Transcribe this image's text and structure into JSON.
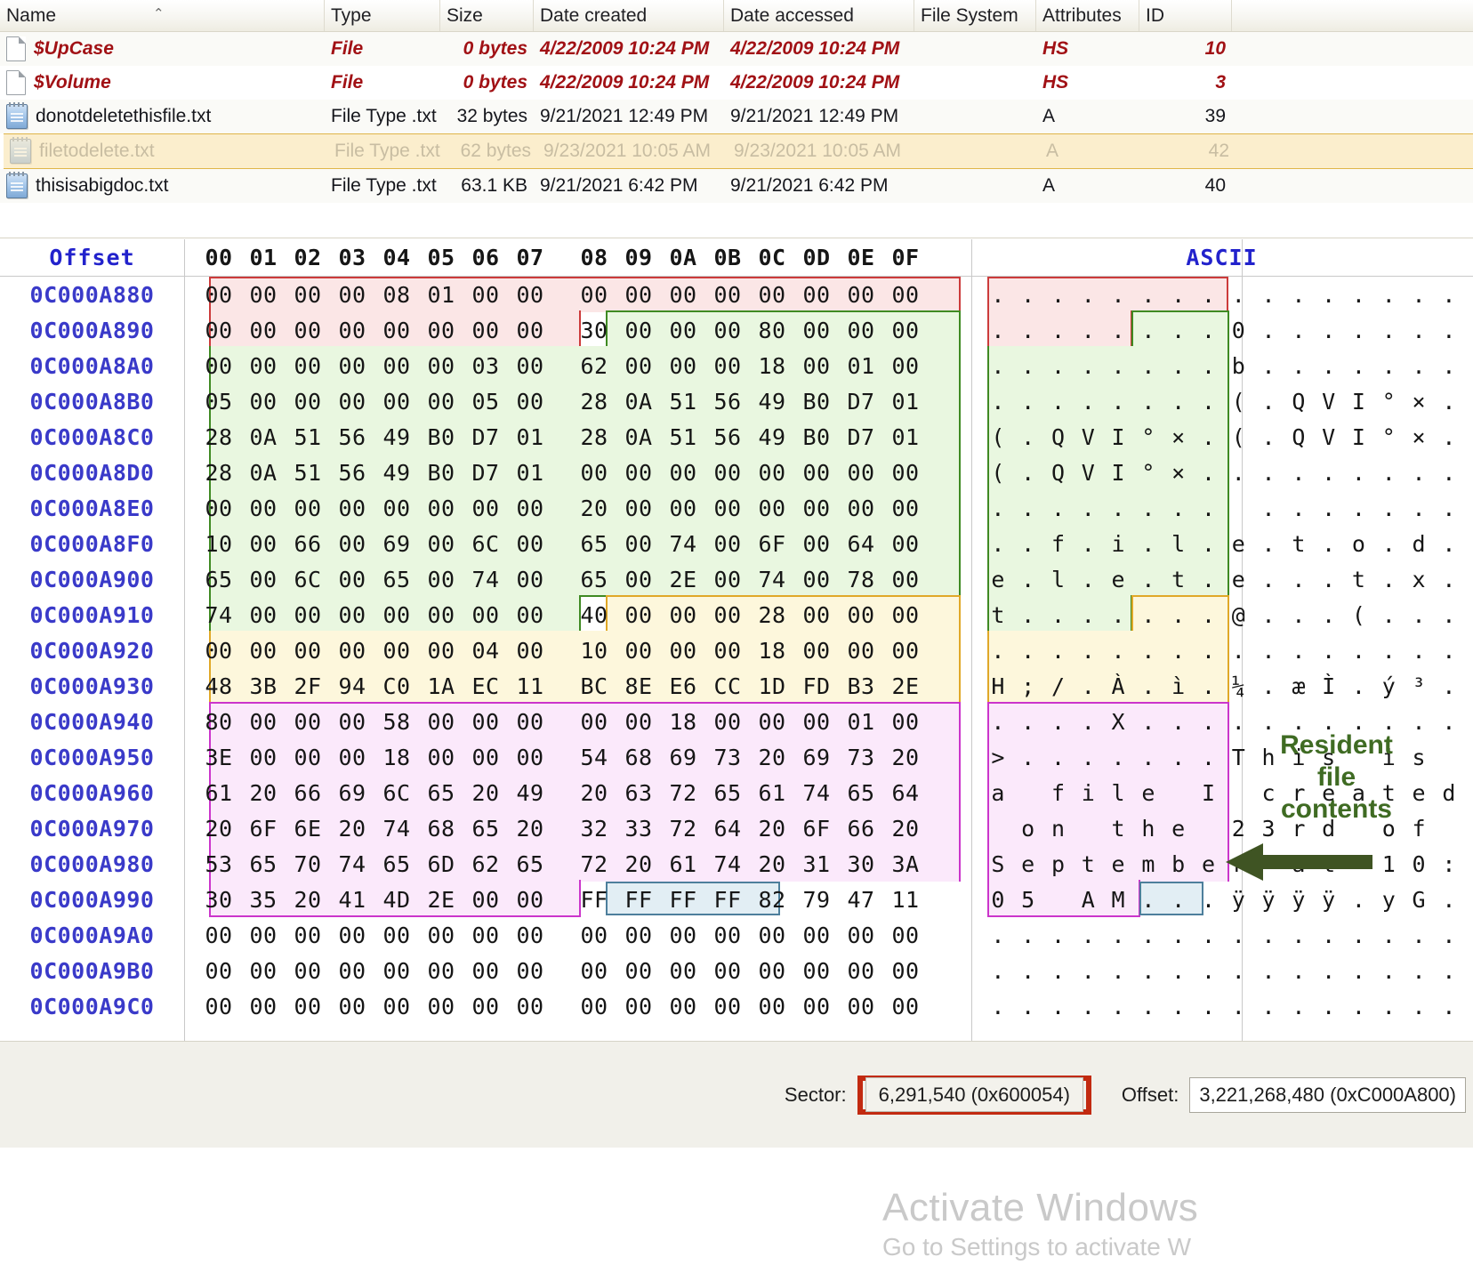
{
  "filelist": {
    "columns": [
      "Name",
      "Type",
      "Size",
      "Date created",
      "Date accessed",
      "File System",
      "Attributes",
      "ID"
    ],
    "sort_indicator": "⌃",
    "rows": [
      {
        "icon": "document-icon",
        "name": "$UpCase",
        "type": "File",
        "size": "0 bytes",
        "created": "4/22/2009 10:24 PM",
        "accessed": "4/22/2009 10:24 PM",
        "fs": "",
        "attr": "HS",
        "id": "10",
        "style": "system"
      },
      {
        "icon": "document-icon",
        "name": "$Volume",
        "type": "File",
        "size": "0 bytes",
        "created": "4/22/2009 10:24 PM",
        "accessed": "4/22/2009 10:24 PM",
        "fs": "",
        "attr": "HS",
        "id": "3",
        "style": "system"
      },
      {
        "icon": "notepad-icon",
        "name": "donotdeletethisfile.txt",
        "type": "File Type .txt",
        "size": "32 bytes",
        "created": "9/21/2021 12:49 PM",
        "accessed": "9/21/2021 12:49 PM",
        "fs": "",
        "attr": "A",
        "id": "39",
        "style": "normal"
      },
      {
        "icon": "notepad-icon",
        "name": "filetodelete.txt",
        "type": "File Type .txt",
        "size": "62 bytes",
        "created": "9/23/2021 10:05 AM",
        "accessed": "9/23/2021 10:05 AM",
        "fs": "",
        "attr": "A",
        "id": "42",
        "style": "deleted-selected"
      },
      {
        "icon": "notepad-icon",
        "name": "thisisabigdoc.txt",
        "type": "File Type .txt",
        "size": "63.1 KB",
        "created": "9/21/2021 6:42 PM",
        "accessed": "9/21/2021 6:42 PM",
        "fs": "",
        "attr": "A",
        "id": "40",
        "style": "normal"
      }
    ]
  },
  "hexview": {
    "header": {
      "offset_label": "Offset",
      "byte_columns": [
        "00",
        "01",
        "02",
        "03",
        "04",
        "05",
        "06",
        "07",
        "08",
        "09",
        "0A",
        "0B",
        "0C",
        "0D",
        "0E",
        "0F"
      ],
      "ascii_label": "ASCII"
    },
    "rows": [
      {
        "offset": "0C000A880",
        "bytes": [
          "00",
          "00",
          "00",
          "00",
          "08",
          "01",
          "00",
          "00",
          "00",
          "00",
          "00",
          "00",
          "00",
          "00",
          "00",
          "00"
        ],
        "ascii": "................"
      },
      {
        "offset": "0C000A890",
        "bytes": [
          "00",
          "00",
          "00",
          "00",
          "00",
          "00",
          "00",
          "00",
          "30",
          "00",
          "00",
          "00",
          "80",
          "00",
          "00",
          "00"
        ],
        "ascii": "........0......."
      },
      {
        "offset": "0C000A8A0",
        "bytes": [
          "00",
          "00",
          "00",
          "00",
          "00",
          "00",
          "03",
          "00",
          "62",
          "00",
          "00",
          "00",
          "18",
          "00",
          "01",
          "00"
        ],
        "ascii": "........b......."
      },
      {
        "offset": "0C000A8B0",
        "bytes": [
          "05",
          "00",
          "00",
          "00",
          "00",
          "00",
          "05",
          "00",
          "28",
          "0A",
          "51",
          "56",
          "49",
          "B0",
          "D7",
          "01"
        ],
        "ascii": "........(.QVI°×."
      },
      {
        "offset": "0C000A8C0",
        "bytes": [
          "28",
          "0A",
          "51",
          "56",
          "49",
          "B0",
          "D7",
          "01",
          "28",
          "0A",
          "51",
          "56",
          "49",
          "B0",
          "D7",
          "01"
        ],
        "ascii": "(.QVI°×.(.QVI°×."
      },
      {
        "offset": "0C000A8D0",
        "bytes": [
          "28",
          "0A",
          "51",
          "56",
          "49",
          "B0",
          "D7",
          "01",
          "00",
          "00",
          "00",
          "00",
          "00",
          "00",
          "00",
          "00"
        ],
        "ascii": "(.QVI°×........."
      },
      {
        "offset": "0C000A8E0",
        "bytes": [
          "00",
          "00",
          "00",
          "00",
          "00",
          "00",
          "00",
          "00",
          "20",
          "00",
          "00",
          "00",
          "00",
          "00",
          "00",
          "00"
        ],
        "ascii": "........ ......."
      },
      {
        "offset": "0C000A8F0",
        "bytes": [
          "10",
          "00",
          "66",
          "00",
          "69",
          "00",
          "6C",
          "00",
          "65",
          "00",
          "74",
          "00",
          "6F",
          "00",
          "64",
          "00"
        ],
        "ascii": "..f.i.l.e.t.o.d."
      },
      {
        "offset": "0C000A900",
        "bytes": [
          "65",
          "00",
          "6C",
          "00",
          "65",
          "00",
          "74",
          "00",
          "65",
          "00",
          "2E",
          "00",
          "74",
          "00",
          "78",
          "00"
        ],
        "ascii": "e.l.e.t.e...t.x."
      },
      {
        "offset": "0C000A910",
        "bytes": [
          "74",
          "00",
          "00",
          "00",
          "00",
          "00",
          "00",
          "00",
          "40",
          "00",
          "00",
          "00",
          "28",
          "00",
          "00",
          "00"
        ],
        "ascii": "t.......@...(..."
      },
      {
        "offset": "0C000A920",
        "bytes": [
          "00",
          "00",
          "00",
          "00",
          "00",
          "00",
          "04",
          "00",
          "10",
          "00",
          "00",
          "00",
          "18",
          "00",
          "00",
          "00"
        ],
        "ascii": "................"
      },
      {
        "offset": "0C000A930",
        "bytes": [
          "48",
          "3B",
          "2F",
          "94",
          "C0",
          "1A",
          "EC",
          "11",
          "BC",
          "8E",
          "E6",
          "CC",
          "1D",
          "FD",
          "B3",
          "2E"
        ],
        "ascii": "H;/.À.ì.¼.æÌ.ý³."
      },
      {
        "offset": "0C000A940",
        "bytes": [
          "80",
          "00",
          "00",
          "00",
          "58",
          "00",
          "00",
          "00",
          "00",
          "00",
          "18",
          "00",
          "00",
          "00",
          "01",
          "00"
        ],
        "ascii": "....X..........."
      },
      {
        "offset": "0C000A950",
        "bytes": [
          "3E",
          "00",
          "00",
          "00",
          "18",
          "00",
          "00",
          "00",
          "54",
          "68",
          "69",
          "73",
          "20",
          "69",
          "73",
          "20"
        ],
        "ascii": ">.......This is "
      },
      {
        "offset": "0C000A960",
        "bytes": [
          "61",
          "20",
          "66",
          "69",
          "6C",
          "65",
          "20",
          "49",
          "20",
          "63",
          "72",
          "65",
          "61",
          "74",
          "65",
          "64"
        ],
        "ascii": "a file I created"
      },
      {
        "offset": "0C000A970",
        "bytes": [
          "20",
          "6F",
          "6E",
          "20",
          "74",
          "68",
          "65",
          "20",
          "32",
          "33",
          "72",
          "64",
          "20",
          "6F",
          "66",
          "20"
        ],
        "ascii": " on the 23rd of "
      },
      {
        "offset": "0C000A980",
        "bytes": [
          "53",
          "65",
          "70",
          "74",
          "65",
          "6D",
          "62",
          "65",
          "72",
          "20",
          "61",
          "74",
          "20",
          "31",
          "30",
          "3A"
        ],
        "ascii": "September at 10:"
      },
      {
        "offset": "0C000A990",
        "bytes": [
          "30",
          "35",
          "20",
          "41",
          "4D",
          "2E",
          "00",
          "00",
          "FF",
          "FF",
          "FF",
          "FF",
          "82",
          "79",
          "47",
          "11"
        ],
        "ascii": "05 AM...ÿÿÿÿ.yG."
      },
      {
        "offset": "0C000A9A0",
        "bytes": [
          "00",
          "00",
          "00",
          "00",
          "00",
          "00",
          "00",
          "00",
          "00",
          "00",
          "00",
          "00",
          "00",
          "00",
          "00",
          "00"
        ],
        "ascii": "................"
      },
      {
        "offset": "0C000A9B0",
        "bytes": [
          "00",
          "00",
          "00",
          "00",
          "00",
          "00",
          "00",
          "00",
          "00",
          "00",
          "00",
          "00",
          "00",
          "00",
          "00",
          "00"
        ],
        "ascii": "................"
      },
      {
        "offset": "0C000A9C0",
        "bytes": [
          "00",
          "00",
          "00",
          "00",
          "00",
          "00",
          "00",
          "00",
          "00",
          "00",
          "00",
          "00",
          "00",
          "00",
          "00",
          "00"
        ],
        "ascii": "................"
      }
    ]
  },
  "annotation": {
    "line1": "Resident",
    "line2": "file",
    "line3": "contents",
    "color": "#3f6b23"
  },
  "watermark": {
    "line1": "Activate Windows",
    "line2": "Go to Settings to activate W"
  },
  "statusbar": {
    "sector_label": "Sector:",
    "sector_value": "6,291,540 (0x600054)",
    "offset_label": "Offset:",
    "offset_value": "3,221,268,480 (0xC000A800)",
    "highlight_color": "#c22a10"
  },
  "highlight_colors": {
    "red": "#cc3b3b",
    "green": "#3f8a23",
    "amber": "#e0a828",
    "pink": "#cb35cb",
    "blue": "#4d7f9c"
  }
}
